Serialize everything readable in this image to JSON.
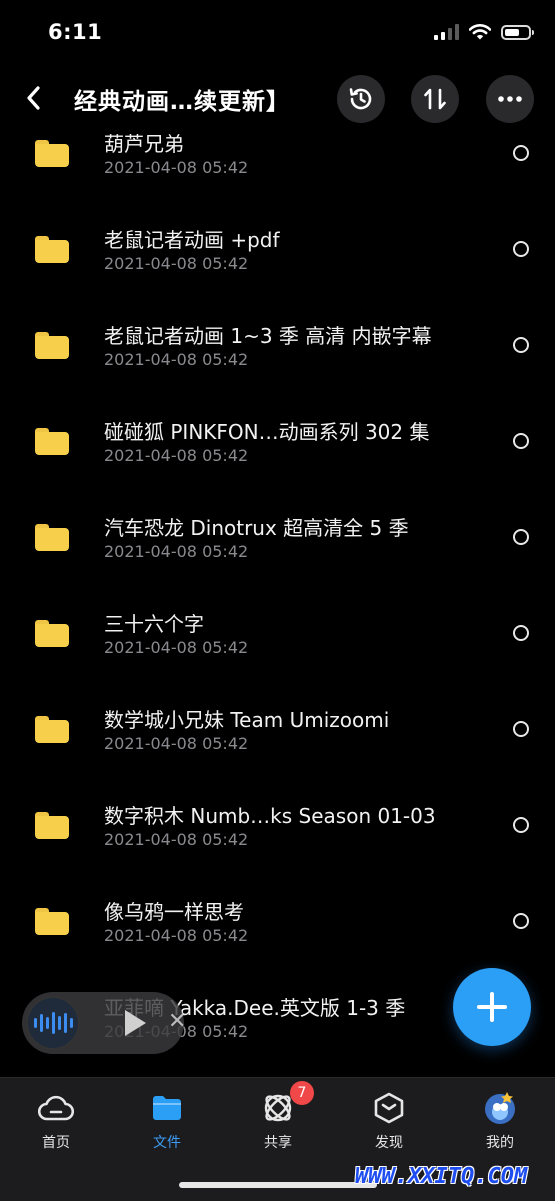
{
  "status_bar": {
    "time": "6:11"
  },
  "header": {
    "title": "经典动画…续更新】"
  },
  "files": [
    {
      "name": "葫芦兄弟",
      "date": "2021-04-08 05:42"
    },
    {
      "name": "老鼠记者动画 +pdf",
      "date": "2021-04-08 05:42"
    },
    {
      "name": "老鼠记者动画 1~3 季 高清 内嵌字幕",
      "date": "2021-04-08 05:42"
    },
    {
      "name": "碰碰狐 PINKFON…动画系列 302 集",
      "date": "2021-04-08 05:42"
    },
    {
      "name": "汽车恐龙 Dinotrux 超高清全 5 季",
      "date": "2021-04-08 05:42"
    },
    {
      "name": "三十六个字",
      "date": "2021-04-08 05:42"
    },
    {
      "name": "数学城小兄妹 Team Umizoomi",
      "date": "2021-04-08 05:42"
    },
    {
      "name": "数字积木 Numb…ks Season 01-03",
      "date": "2021-04-08 05:42"
    },
    {
      "name": "像乌鸦一样思考",
      "date": "2021-04-08 05:42"
    },
    {
      "name": "亚菲嘀 Yakka.Dee.英文版 1-3 季",
      "date": "2021-04-08 05:42"
    }
  ],
  "tabbar": {
    "items": [
      {
        "label": "首页",
        "icon": "cloud-icon",
        "active": false
      },
      {
        "label": "文件",
        "icon": "folder-icon",
        "active": true
      },
      {
        "label": "共享",
        "icon": "share-orbit-icon",
        "active": false
      },
      {
        "label": "发现",
        "icon": "discover-cube-icon",
        "active": false
      },
      {
        "label": "我的",
        "icon": "avatar-icon",
        "active": false
      }
    ],
    "share_badge": "7"
  },
  "watermark": "WWW.XXITQ.COM",
  "colors": {
    "accent": "#2b9ef6",
    "folder": "#f8cf4a",
    "badge": "#f04848"
  }
}
